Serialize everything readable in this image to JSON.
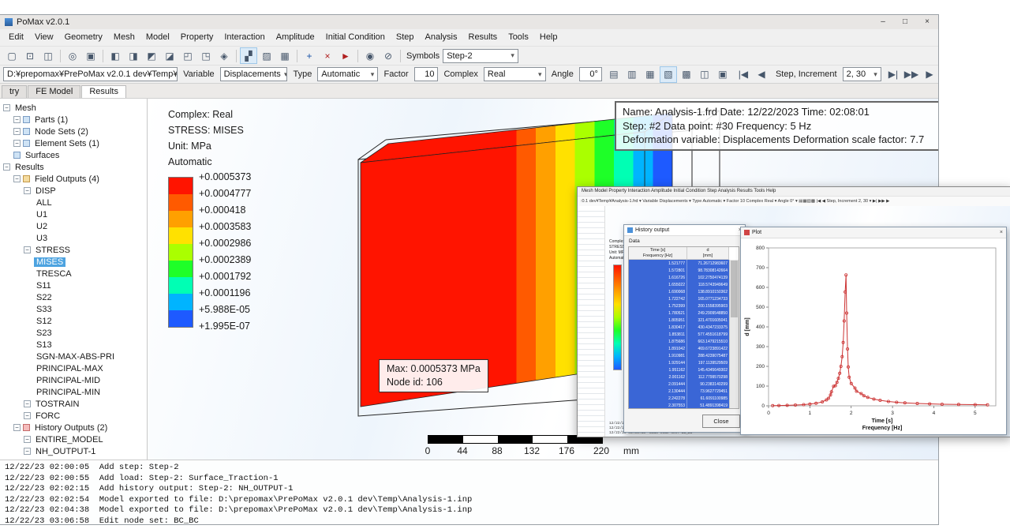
{
  "window": {
    "title": "PoMax v2.0.1",
    "minimize_icon": "–",
    "maximize_icon": "□",
    "close_icon": "×"
  },
  "menu": {
    "items": [
      "Edit",
      "View",
      "Geometry",
      "Mesh",
      "Model",
      "Property",
      "Interaction",
      "Amplitude",
      "Initial Condition",
      "Step",
      "Analysis",
      "Results",
      "Tools",
      "Help"
    ]
  },
  "toolbar1": {
    "icons": [
      {
        "name": "new-file-icon",
        "glyph": "▢"
      },
      {
        "name": "open-file-icon",
        "glyph": "⊡"
      },
      {
        "name": "save-icon",
        "glyph": "◫"
      },
      {
        "sep": true
      },
      {
        "name": "zoom-icon",
        "glyph": "◎"
      },
      {
        "name": "fit-view-icon",
        "glyph": "▣"
      },
      {
        "sep": true
      },
      {
        "name": "front-view-icon",
        "glyph": "◧"
      },
      {
        "name": "back-view-icon",
        "glyph": "◨"
      },
      {
        "name": "left-view-icon",
        "glyph": "◩"
      },
      {
        "name": "right-view-icon",
        "glyph": "◪"
      },
      {
        "name": "top-view-icon",
        "glyph": "◰"
      },
      {
        "name": "bottom-view-icon",
        "glyph": "◳"
      },
      {
        "name": "iso-view-icon",
        "glyph": "◈"
      },
      {
        "sep": true
      },
      {
        "name": "section-view-icon",
        "glyph": "▞",
        "pressed": true
      },
      {
        "name": "transparency-icon",
        "glyph": "▨"
      },
      {
        "name": "wireframe-icon",
        "glyph": "▦"
      },
      {
        "sep": true
      },
      {
        "name": "query-icon",
        "glyph": "+",
        "color": "#1a54a8"
      },
      {
        "name": "remove-annotations-icon",
        "glyph": "×",
        "color": "#b02020"
      },
      {
        "name": "arrow-annotation-icon",
        "glyph": "►",
        "color": "#b02020"
      },
      {
        "sep": true
      },
      {
        "name": "show-icon",
        "glyph": "◉"
      },
      {
        "name": "hide-icon",
        "glyph": "⊘"
      },
      {
        "sep": true
      }
    ],
    "symbols_label": "Symbols",
    "symbols_value": "Step-2"
  },
  "toolbar2": {
    "file_path": "D:¥prepomax¥PrePoMax v2.0.1 dev¥Temp¥Analysis-1.frd",
    "variable_label": "Variable",
    "variable_value": "Displacements",
    "type_label": "Type",
    "type_value": "Automatic",
    "factor_label": "Factor",
    "factor_value": "10",
    "complex_label": "Complex",
    "complex_value": "Real",
    "angle_label": "Angle",
    "angle_value": "0°",
    "view_icons": [
      {
        "name": "deformed-icon",
        "glyph": "▤"
      },
      {
        "name": "undeformed-icon",
        "glyph": "▥"
      },
      {
        "name": "deformed-undeformed-icon",
        "glyph": "▦"
      },
      {
        "name": "result-contour-icon",
        "glyph": "▧",
        "pressed": true
      },
      {
        "name": "no-contour-icon",
        "glyph": "▩"
      },
      {
        "name": "animate-icon",
        "glyph": "◫"
      },
      {
        "name": "record-icon",
        "glyph": "▣"
      }
    ],
    "nav_prev_icons": [
      {
        "name": "first-increment-icon",
        "glyph": "|◀"
      },
      {
        "name": "previous-increment-icon",
        "glyph": "◀"
      }
    ],
    "step_label": "Step, Increment",
    "step_value": "2, 30",
    "nav_next_icons": [
      {
        "name": "next-increment-icon",
        "glyph": "▶|"
      },
      {
        "name": "last-increment-icon",
        "glyph": "▶▶"
      },
      {
        "name": "play-animation-icon",
        "glyph": "▶"
      }
    ]
  },
  "tabs": {
    "items": [
      {
        "label": "try",
        "active": false
      },
      {
        "label": "FE Model",
        "active": false
      },
      {
        "label": "Results",
        "active": true
      }
    ]
  },
  "tree": {
    "items": [
      {
        "label": "Mesh",
        "depth": 0,
        "expander": true
      },
      {
        "label": "Parts (1)",
        "depth": 1,
        "expander": true,
        "icon": "box"
      },
      {
        "label": "Node Sets (2)",
        "depth": 1,
        "expander": true,
        "icon": "box"
      },
      {
        "label": "Element Sets (1)",
        "depth": 1,
        "expander": true,
        "icon": "box"
      },
      {
        "label": "Surfaces",
        "depth": 1,
        "icon": "box"
      },
      {
        "label": "Results",
        "depth": 0,
        "expander": true
      },
      {
        "label": "Field Outputs (4)",
        "depth": 1,
        "expander": true,
        "icon": "field"
      },
      {
        "label": "DISP",
        "depth": 2,
        "expander": true
      },
      {
        "label": "ALL",
        "depth": 3
      },
      {
        "label": "U1",
        "depth": 3
      },
      {
        "label": "U2",
        "depth": 3
      },
      {
        "label": "U3",
        "depth": 3
      },
      {
        "label": "STRESS",
        "depth": 2,
        "expander": true
      },
      {
        "label": "MISES",
        "depth": 3,
        "selected": true
      },
      {
        "label": "TRESCA",
        "depth": 3
      },
      {
        "label": "S11",
        "depth": 3
      },
      {
        "label": "S22",
        "depth": 3
      },
      {
        "label": "S33",
        "depth": 3
      },
      {
        "label": "S12",
        "depth": 3
      },
      {
        "label": "S23",
        "depth": 3
      },
      {
        "label": "S13",
        "depth": 3
      },
      {
        "label": "SGN-MAX-ABS-PRI",
        "depth": 3
      },
      {
        "label": "PRINCIPAL-MAX",
        "depth": 3
      },
      {
        "label": "PRINCIPAL-MID",
        "depth": 3
      },
      {
        "label": "PRINCIPAL-MIN",
        "depth": 3
      },
      {
        "label": "TOSTRAIN",
        "depth": 2,
        "expander": true
      },
      {
        "label": "FORC",
        "depth": 2,
        "expander": true
      },
      {
        "label": "History Outputs (2)",
        "depth": 1,
        "expander": true,
        "icon": "history"
      },
      {
        "label": "ENTIRE_MODEL",
        "depth": 2,
        "expander": true
      },
      {
        "label": "NH_OUTPUT-1",
        "depth": 2,
        "expander": true
      }
    ]
  },
  "viewport": {
    "legend": {
      "header_lines": [
        "Complex: Real",
        "STRESS: MISES",
        "Unit: MPa",
        "Automatic"
      ],
      "values": [
        "+0.0005373",
        "+0.0004777",
        "+0.000418",
        "+0.0003583",
        "+0.0002986",
        "+0.0002389",
        "+0.0001792",
        "+0.0001196",
        "+5.988E-05",
        "+1.995E-07"
      ],
      "colors": [
        "#ff1400",
        "#ff5a00",
        "#ffa000",
        "#ffe100",
        "#aaff00",
        "#1eff28",
        "#00ffb4",
        "#00b4ff",
        "#1e5aff"
      ]
    },
    "info_box": {
      "line1": "Name: Analysis-1.frd   Date: 12/22/2023   Time: 02:08:01",
      "line2": "Step: #2   Data point: #30   Frequency: 5 Hz",
      "line3": "Deformation variable: Displacements   Deformation scale factor: 7.7"
    },
    "max_annotation": {
      "line1": "Max: 0.0005373 MPa",
      "line2": "Node id: 106"
    },
    "scale_bar": {
      "ticks": [
        "0",
        "44",
        "88",
        "132",
        "176",
        "220"
      ],
      "unit": "mm"
    }
  },
  "log": {
    "lines": [
      "12/22/23 02:00:05  Add step: Step-2",
      "12/22/23 02:00:55  Add load: Step-2: Surface_Traction-1",
      "12/22/23 02:02:15  Add history output: Step-2: NH_OUTPUT-1",
      "12/22/23 02:02:54  Model exported to file: D:\\prepomax\\PrePoMax v2.0.1 dev\\Temp\\Analysis-1.inp",
      "12/22/23 02:04:38  Model exported to file: D:\\prepomax\\PrePoMax v2.0.1 dev\\Temp\\Analysis-1.inp",
      "12/22/23 03:06:58  Edit node set: BC_BC"
    ]
  },
  "overlay": {
    "menu_text": "Mesh    Model    Property    Interaction    Amplitude    Initial Condition    Step    Analysis    Results    Tools    Help",
    "toolbar_text": ":0.1 dev¥Temp¥Analysis-1.frd ▾   Variable  Displacements ▾   Type  Automatic ▾   Factor  10   Complex  Real ▾   Angle  0° ▾   ▤▦▧▩   |◀ ◀   Step, Increment  2, 30 ▾   ▶| ▶▶ ▶",
    "legend_lines": [
      "Complex: Real",
      "STRESS: MISES",
      "Unit: MPa",
      "Automatic"
    ],
    "log_lines": [
      "12/22/23 02:02:54  Model exported to file: D:\\prepomax\\PrePoMax v2.0.1 dev\\Temp\\Analysis-1.inp",
      "12/22/23 02:04:38  Model exported to file: D:\\prepomax\\PrePoMax v2.0.1 dev\\Temp\\Analysis-1.inp",
      "12/22/23 03:06:58  Edit node set: BC_BC"
    ],
    "history_dialog": {
      "title": "History output",
      "data_label": "Data",
      "col1_line1": "Time [s]",
      "col1_line2": "Frequency [Hz]",
      "col2_line1": "d",
      "col2_line2": "[mm]",
      "close_label": "Close",
      "rows": [
        [
          "1.521777",
          "71.26712983607"
        ],
        [
          "1.572801",
          "98.78308142664"
        ],
        [
          "1.616726",
          "102.2750474139"
        ],
        [
          "1.655022",
          "118.5743949649"
        ],
        [
          "1.690068",
          "138.8910150362"
        ],
        [
          "1.722742",
          "165.0771234733"
        ],
        [
          "1.752399",
          "200.1558395903"
        ],
        [
          "1.780521",
          "249.2909548850"
        ],
        [
          "1.805951",
          "321.4701605041"
        ],
        [
          "1.830417",
          "430.4347233375"
        ],
        [
          "1.853811",
          "577.4551618799"
        ],
        [
          "1.875686",
          "663.1479215510"
        ],
        [
          "1.891042",
          "469.6723891422"
        ],
        [
          "1.910981",
          "288.4239075487"
        ],
        [
          "1.929144",
          "197.1139529509"
        ],
        [
          "1.951162",
          "145.4345649302"
        ],
        [
          "2.001162",
          "112.7799570298"
        ],
        [
          "2.091444",
          "90.2383140299"
        ],
        [
          "2.130444",
          "73.9627729451"
        ],
        [
          "2.242278",
          "61.6091100985"
        ],
        [
          "2.307553",
          "51.4891398419"
        ]
      ]
    },
    "plot_window": {
      "title": "Plot"
    }
  },
  "chart_data": {
    "type": "line",
    "title": "Plot",
    "xlabel": "Time [s] / Frequency [Hz]",
    "xlabel_lines": [
      "Time [s]",
      "Frequency [Hz]"
    ],
    "ylabel": "d [mm]",
    "xlim": [
      0,
      5.5
    ],
    "ylim": [
      0,
      800
    ],
    "xticks": [
      0,
      1,
      2,
      3,
      4,
      5
    ],
    "yticks": [
      0,
      100,
      200,
      300,
      400,
      500,
      600,
      700,
      800
    ],
    "grid": false,
    "legend_position": "none",
    "line_color": "#cc3333",
    "points": [
      [
        0.1,
        1
      ],
      [
        0.25,
        1.5
      ],
      [
        0.45,
        2.5
      ],
      [
        0.65,
        4
      ],
      [
        0.85,
        6
      ],
      [
        1.0,
        9
      ],
      [
        1.15,
        13
      ],
      [
        1.3,
        20
      ],
      [
        1.4,
        30
      ],
      [
        1.45,
        38
      ],
      [
        1.5,
        55
      ],
      [
        1.522,
        71
      ],
      [
        1.573,
        99
      ],
      [
        1.617,
        102
      ],
      [
        1.655,
        119
      ],
      [
        1.69,
        139
      ],
      [
        1.723,
        165
      ],
      [
        1.752,
        200
      ],
      [
        1.781,
        249
      ],
      [
        1.806,
        321
      ],
      [
        1.83,
        430
      ],
      [
        1.854,
        577
      ],
      [
        1.876,
        663
      ],
      [
        1.891,
        470
      ],
      [
        1.911,
        288
      ],
      [
        1.929,
        197
      ],
      [
        1.951,
        145
      ],
      [
        2.001,
        113
      ],
      [
        2.091,
        90
      ],
      [
        2.13,
        74
      ],
      [
        2.242,
        62
      ],
      [
        2.308,
        51
      ],
      [
        2.4,
        43
      ],
      [
        2.55,
        34
      ],
      [
        2.7,
        28
      ],
      [
        2.9,
        22
      ],
      [
        3.1,
        18
      ],
      [
        3.3,
        15
      ],
      [
        3.6,
        12
      ],
      [
        3.9,
        10
      ],
      [
        4.2,
        8
      ],
      [
        4.6,
        7
      ],
      [
        5.0,
        6
      ],
      [
        5.3,
        5
      ]
    ]
  }
}
